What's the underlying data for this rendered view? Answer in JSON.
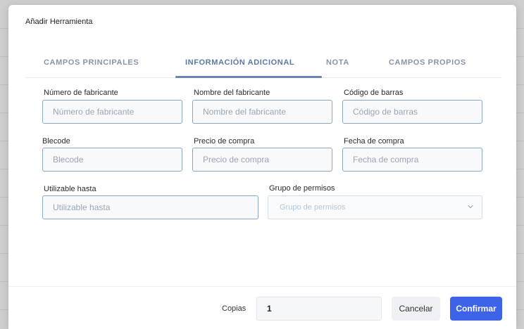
{
  "dialog": {
    "title": "Añadir Herramienta"
  },
  "tabs": [
    {
      "label": "CAMPOS PRINCIPALES",
      "active": false
    },
    {
      "label": "INFORMACIÓN ADICIONAL",
      "active": true
    },
    {
      "label": "NOTA",
      "active": false
    },
    {
      "label": "CAMPOS PROPIOS",
      "active": false
    }
  ],
  "fields": {
    "manufacturer_number": {
      "label": "Número de fabricante",
      "placeholder": "Número de fabricante",
      "value": ""
    },
    "manufacturer_name": {
      "label": "Nombre del fabricante",
      "placeholder": "Nombre del fabricante",
      "value": ""
    },
    "barcode": {
      "label": "Código de barras",
      "placeholder": "Código de barras",
      "value": ""
    },
    "blecode": {
      "label": "Blecode",
      "placeholder": "Blecode",
      "value": ""
    },
    "purchase_price": {
      "label": "Precio de compra",
      "placeholder": "Precio de compra",
      "value": ""
    },
    "purchase_date": {
      "label": "Fecha de compra",
      "placeholder": "Fecha de compra",
      "value": ""
    },
    "usable_until": {
      "label": "Utilizable hasta",
      "placeholder": "Utilizable hasta",
      "value": ""
    },
    "permission_group": {
      "label": "Grupo de permisos",
      "placeholder": "Grupo de permisos",
      "icon": "chevron-down-icon"
    }
  },
  "footer": {
    "copies_label": "Copias",
    "copies_value": "1",
    "cancel_label": "Cancelar",
    "confirm_label": "Confirmar"
  },
  "colors": {
    "accent": "#3d63e8",
    "active_tab": "#5b78a8",
    "input_border": "#8aa7c8"
  }
}
